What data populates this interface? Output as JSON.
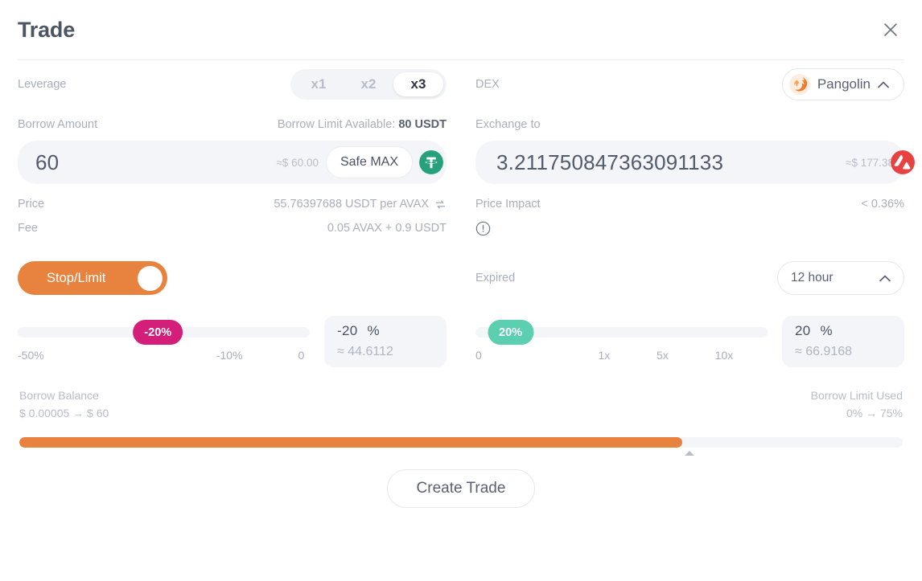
{
  "header": {
    "title": "Trade",
    "close_icon": "close-icon"
  },
  "left": {
    "leverage_label": "Leverage",
    "leverage_options": [
      {
        "label": "x1",
        "active": false
      },
      {
        "label": "x2",
        "active": false
      },
      {
        "label": "x3",
        "active": true
      }
    ],
    "borrow_amount_label": "Borrow Amount",
    "borrow_limit_prefix": "Borrow Limit Available:",
    "borrow_limit_value": "80  USDT",
    "amount_value": "60",
    "amount_placeholder": "0",
    "amount_approx": "≈$ 60.00",
    "safe_max_label": "Safe MAX",
    "coin_icon": "usdt-icon",
    "price_label": "Price",
    "price_value": "55.76397688  USDT per AVAX",
    "swap_icon": "swap-icon",
    "fee_label": "Fee",
    "fee_value": "0.05 AVAX + 0.9 USDT",
    "toggle_label": "Stop/Limit",
    "toggle_on": true,
    "slider": {
      "thumb_label": "-20%",
      "thumb_percent": 48,
      "ticks": [
        {
          "label": "-50%",
          "pos": 0
        },
        {
          "label": "-10%",
          "pos": 68
        },
        {
          "label": "0",
          "pos": 96
        }
      ],
      "value": "-20",
      "unit": "%",
      "approx": "≈ 44.6112"
    }
  },
  "right": {
    "dex_label": "DEX",
    "dex_name": "Pangolin",
    "dex_icon": "pangolin-icon",
    "dex_caret_icon": "chevron-up-icon",
    "exchange_to_label": "Exchange to",
    "exchange_value": "3.211750847363091133",
    "exchange_approx": "≈$ 177.38",
    "exchange_coin_icon": "avax-icon",
    "price_impact_label": "Price Impact",
    "price_impact_value": "< 0.36%",
    "warning_icon": "info-circle-icon",
    "expired_label": "Expired",
    "expired_value": "12 hour",
    "expired_caret_icon": "chevron-up-icon",
    "slider": {
      "thumb_label": "20%",
      "thumb_percent": 12,
      "ticks": [
        {
          "label": "0",
          "pos": 0
        },
        {
          "label": "1x",
          "pos": 42
        },
        {
          "label": "5x",
          "pos": 62
        },
        {
          "label": "10x",
          "pos": 82
        }
      ],
      "value": "20",
      "unit": "%",
      "approx": "≈ 66.9168"
    }
  },
  "summary": {
    "borrow_balance_label": "Borrow Balance",
    "borrow_balance_value": "$ 0.00005 → $ 60",
    "borrow_limit_used_label": "Borrow Limit Used",
    "borrow_limit_used_value": "0% → 75%",
    "progress_percent": 75
  },
  "footer": {
    "cta_label": "Create Trade"
  },
  "colors": {
    "accent_orange": "#e8823f",
    "slider_pink": "#d31f7a",
    "slider_teal": "#5bcfb0",
    "avax_red": "#e84142",
    "usdt_green": "#26a17b",
    "muted": "#a9aebb"
  }
}
